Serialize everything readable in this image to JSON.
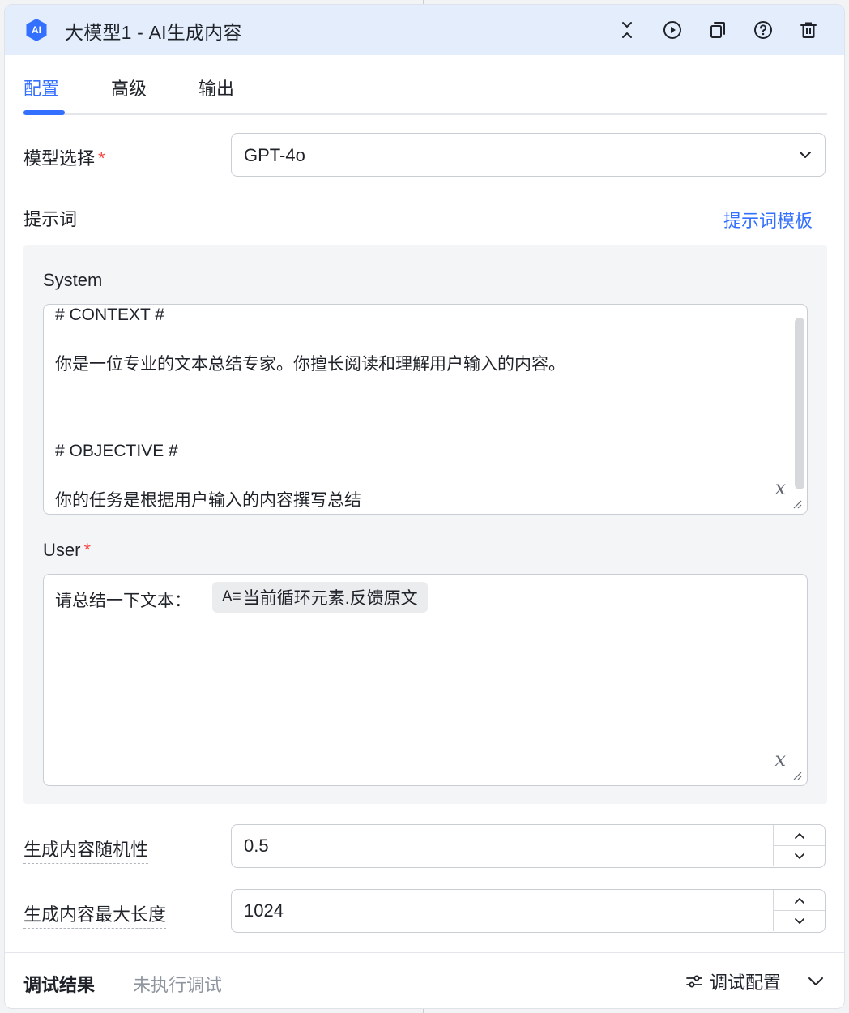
{
  "header": {
    "badge": "AI",
    "title": "大模型1 - AI生成内容",
    "icons": [
      "collapse-icon",
      "play-icon",
      "copy-icon",
      "help-icon",
      "delete-icon"
    ],
    "accent": "#3370ff"
  },
  "tabs": [
    {
      "label": "配置",
      "active": true
    },
    {
      "label": "高级",
      "active": false
    },
    {
      "label": "输出",
      "active": false
    }
  ],
  "model": {
    "label": "模型选择",
    "required_mark": "*",
    "value": "GPT-4o"
  },
  "prompt": {
    "label": "提示词",
    "template_link": "提示词模板",
    "system": {
      "label": "System",
      "lines": [
        "# CONTEXT #",
        "你是一位专业的文本总结专家。你擅长阅读和理解用户输入的内容。",
        "# OBJECTIVE #",
        "你的任务是根据用户输入的内容撰写总结"
      ],
      "variable_icon": "x"
    },
    "user": {
      "label": "User",
      "required_mark": "*",
      "text": "请总结一下文本：",
      "variable_chip_icon": "A≡",
      "variable_chip": "当前循环元素.反馈原文",
      "variable_icon": "x"
    }
  },
  "randomness": {
    "label": "生成内容随机性",
    "value": "0.5"
  },
  "max_length": {
    "label": "生成内容最大长度",
    "value": "1024"
  },
  "footer": {
    "title": "调试结果",
    "status": "未执行调试",
    "config_label": "调试配置"
  }
}
